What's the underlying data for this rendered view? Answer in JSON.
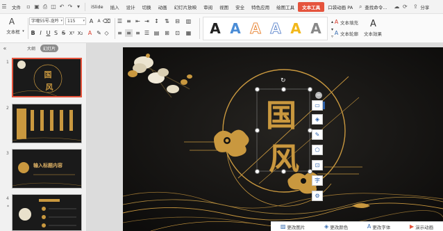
{
  "menubar": {
    "file": "文件",
    "islide": "iSlide",
    "items": [
      "插入",
      "设计",
      "切换",
      "动画",
      "幻灯片放映",
      "审阅",
      "视图",
      "安全",
      "特色应用",
      "绘图工具"
    ],
    "active": "文本工具",
    "extra": "口袋动画 PA",
    "search": "查找命令...",
    "share": "分享"
  },
  "ribbon": {
    "textbox": "文本框",
    "font": "字魂55号-龙吟",
    "size": "115",
    "text_fill": "文本填充",
    "text_outline": "文本轮廓",
    "text_effect": "文本效果",
    "style_letters": [
      "A",
      "A",
      "A",
      "A",
      "A",
      "A"
    ],
    "style_colors": [
      "#222222",
      "#4a8cd6",
      "#e98a3c",
      "#6a8fd0",
      "#f2b81b",
      "#888888"
    ]
  },
  "left_pane": {
    "tab_outline": "大纲",
    "tab_slides": "幻灯片",
    "slide_numbers": [
      "1",
      "2",
      "3",
      "4"
    ],
    "slide3_title": "输入标题内容"
  },
  "slide": {
    "title_chars": [
      "国",
      "风"
    ]
  },
  "side_tools": [
    "layout-icon",
    "layers-icon",
    "pen-icon",
    "shape-icon",
    "crop-icon",
    "text-icon",
    "more-icon"
  ],
  "bottom_bar": {
    "change_picture": "更改图片",
    "change_color": "更改颜色",
    "change_font": "更改字体",
    "play_animation": "演示动画"
  },
  "colors": {
    "accent": "#e5533c",
    "gold": "#c9983f",
    "slide_bg": "#131211"
  }
}
